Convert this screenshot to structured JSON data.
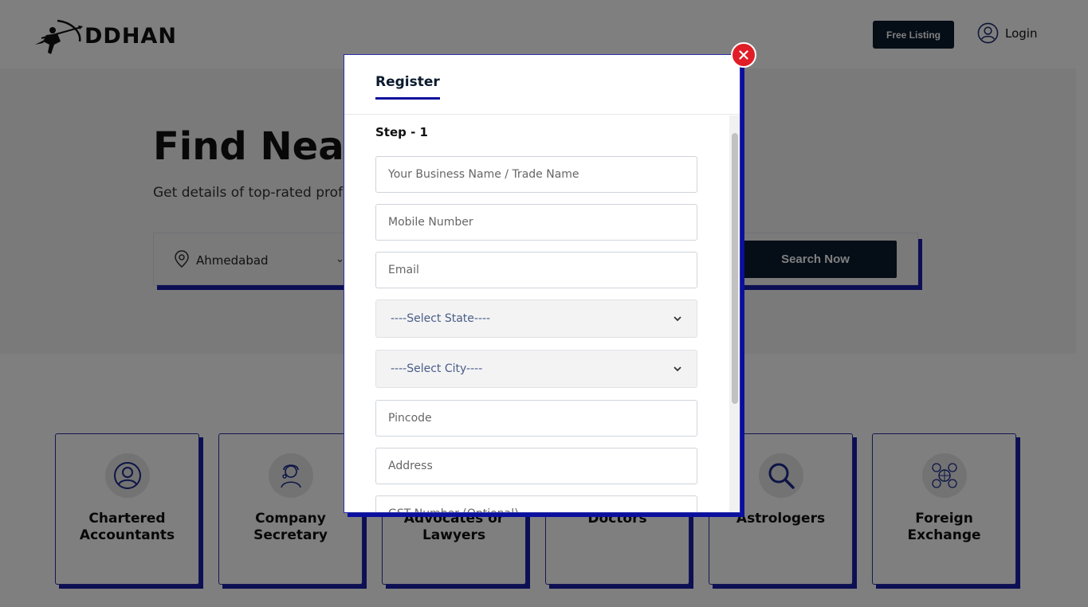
{
  "header": {
    "brand": "DDHAN",
    "free_listing_label": "Free Listing",
    "login_label": "Login"
  },
  "hero": {
    "title": "Find Nearby Professionals",
    "subtitle": "Get details of top-rated professionals near you",
    "location_value": "Ahmedabad",
    "search_button_label": "Search Now"
  },
  "categories": [
    {
      "label": "Chartered Accountants",
      "icon": "user-circle-icon"
    },
    {
      "label": "Company Secretary",
      "icon": "secretary-icon"
    },
    {
      "label": "Advocates or Lawyers",
      "icon": "lawyer-icon"
    },
    {
      "label": "Doctors",
      "icon": "doctor-icon"
    },
    {
      "label": "Astrologers",
      "icon": "search-icon"
    },
    {
      "label": "Foreign Exchange",
      "icon": "currency-exchange-icon"
    }
  ],
  "modal": {
    "tab_label": "Register",
    "step_label": "Step - 1",
    "fields": {
      "business_name_placeholder": "Your Business Name / Trade Name",
      "mobile_placeholder": "Mobile Number",
      "email_placeholder": "Email",
      "state_selected": "----Select State----",
      "city_selected": "----Select City----",
      "pincode_placeholder": "Pincode",
      "address_placeholder": "Address",
      "gst_placeholder": "GST Number (Optional)"
    }
  },
  "colors": {
    "accent_blue": "#0b0f9e",
    "dark_button": "#0b1a2e",
    "close_red": "#e01e27"
  }
}
